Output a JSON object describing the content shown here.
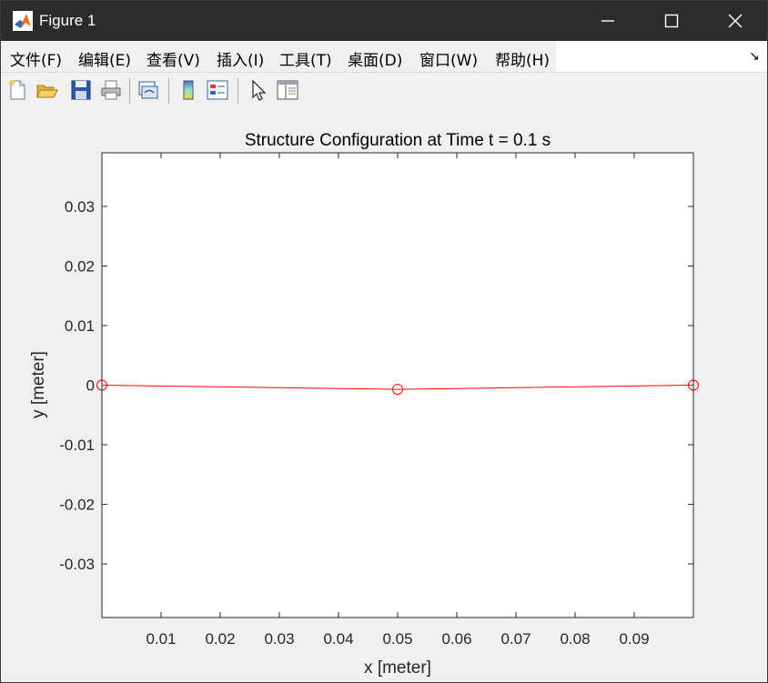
{
  "window": {
    "title": "Figure 1"
  },
  "menu": {
    "items": [
      "文件(F)",
      "编辑(E)",
      "查看(V)",
      "插入(I)",
      "工具(T)",
      "桌面(D)",
      "窗口(W)",
      "帮助(H)"
    ]
  },
  "toolbar": {
    "icons": [
      "new-figure-icon",
      "open-file-icon",
      "save-icon",
      "print-icon",
      "link-plot-icon",
      "insert-colorbar-icon",
      "insert-legend-icon",
      "edit-plot-icon",
      "property-inspector-icon"
    ]
  },
  "colors": {
    "line": "#ff0000",
    "marker": "#ff0000",
    "titlebar": "#2b2b2b",
    "figure_bg": "#f0f0f0"
  },
  "chart_data": {
    "type": "line",
    "title": "Structure Configuration at Time t = 0.1 s",
    "xlabel": "x [meter]",
    "ylabel": "y [meter]",
    "xlim": [
      0,
      0.1
    ],
    "ylim": [
      -0.039,
      0.039
    ],
    "xticks": [
      0.01,
      0.02,
      0.03,
      0.04,
      0.05,
      0.06,
      0.07,
      0.08,
      0.09
    ],
    "xtick_labels": [
      "0.01",
      "0.02",
      "0.03",
      "0.04",
      "0.05",
      "0.06",
      "0.07",
      "0.08",
      "0.09"
    ],
    "yticks": [
      0.03,
      0.02,
      0.01,
      0,
      -0.01,
      -0.02,
      -0.03
    ],
    "ytick_labels": [
      "0.03",
      "0.02",
      "0.01",
      "0",
      "-0.01",
      "-0.02",
      "-0.03"
    ],
    "grid": false,
    "marker": "circle",
    "series": [
      {
        "x": [
          0,
          0.05,
          0.1
        ],
        "y": [
          0,
          -0.0007,
          0
        ]
      }
    ]
  }
}
